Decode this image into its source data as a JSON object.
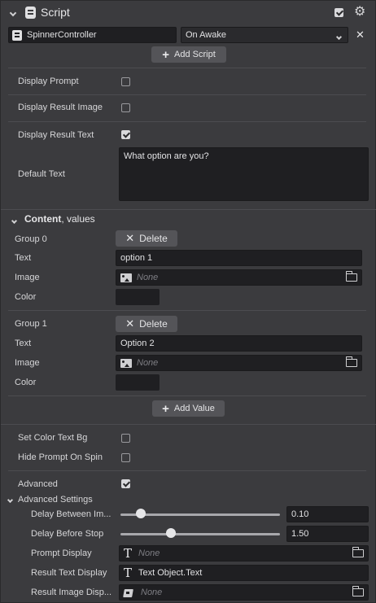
{
  "header": {
    "title": "Script"
  },
  "script_row": {
    "script_name": "SpinnerController",
    "event": "On Awake",
    "add_script": "Add Script"
  },
  "props": {
    "display_prompt": {
      "label": "Display Prompt",
      "checked": false
    },
    "display_result_image": {
      "label": "Display Result Image",
      "checked": false
    },
    "display_result_text": {
      "label": "Display Result Text",
      "checked": true
    },
    "default_text": {
      "label": "Default Text",
      "value": "What option are you?"
    }
  },
  "content": {
    "title": "Content",
    "subtitle": ", values",
    "groups": [
      {
        "label": "Group 0",
        "delete": "Delete",
        "text_label": "Text",
        "text_value": "option 1",
        "image_label": "Image",
        "image_value": "None",
        "color_label": "Color"
      },
      {
        "label": "Group 1",
        "delete": "Delete",
        "text_label": "Text",
        "text_value": "Option 2",
        "image_label": "Image",
        "image_value": "None",
        "color_label": "Color"
      }
    ],
    "add_value": "Add Value"
  },
  "options": {
    "set_color_text_bg": {
      "label": "Set Color Text Bg",
      "checked": false
    },
    "hide_prompt_on_spin": {
      "label": "Hide Prompt On Spin",
      "checked": false
    },
    "advanced": {
      "label": "Advanced",
      "checked": true
    }
  },
  "advanced_settings": {
    "title": "Advanced Settings",
    "delay_between": {
      "label": "Delay Between Im...",
      "value": "0.10",
      "fraction": 0.13
    },
    "delay_before_stop": {
      "label": "Delay Before Stop",
      "value": "1.50",
      "fraction": 0.31
    },
    "prompt_display": {
      "label": "Prompt Display",
      "value": "None"
    },
    "result_text_display": {
      "label": "Result Text Display",
      "value": "Text Object.Text"
    },
    "result_image_display": {
      "label": "Result Image Disp...",
      "value": "None"
    }
  }
}
